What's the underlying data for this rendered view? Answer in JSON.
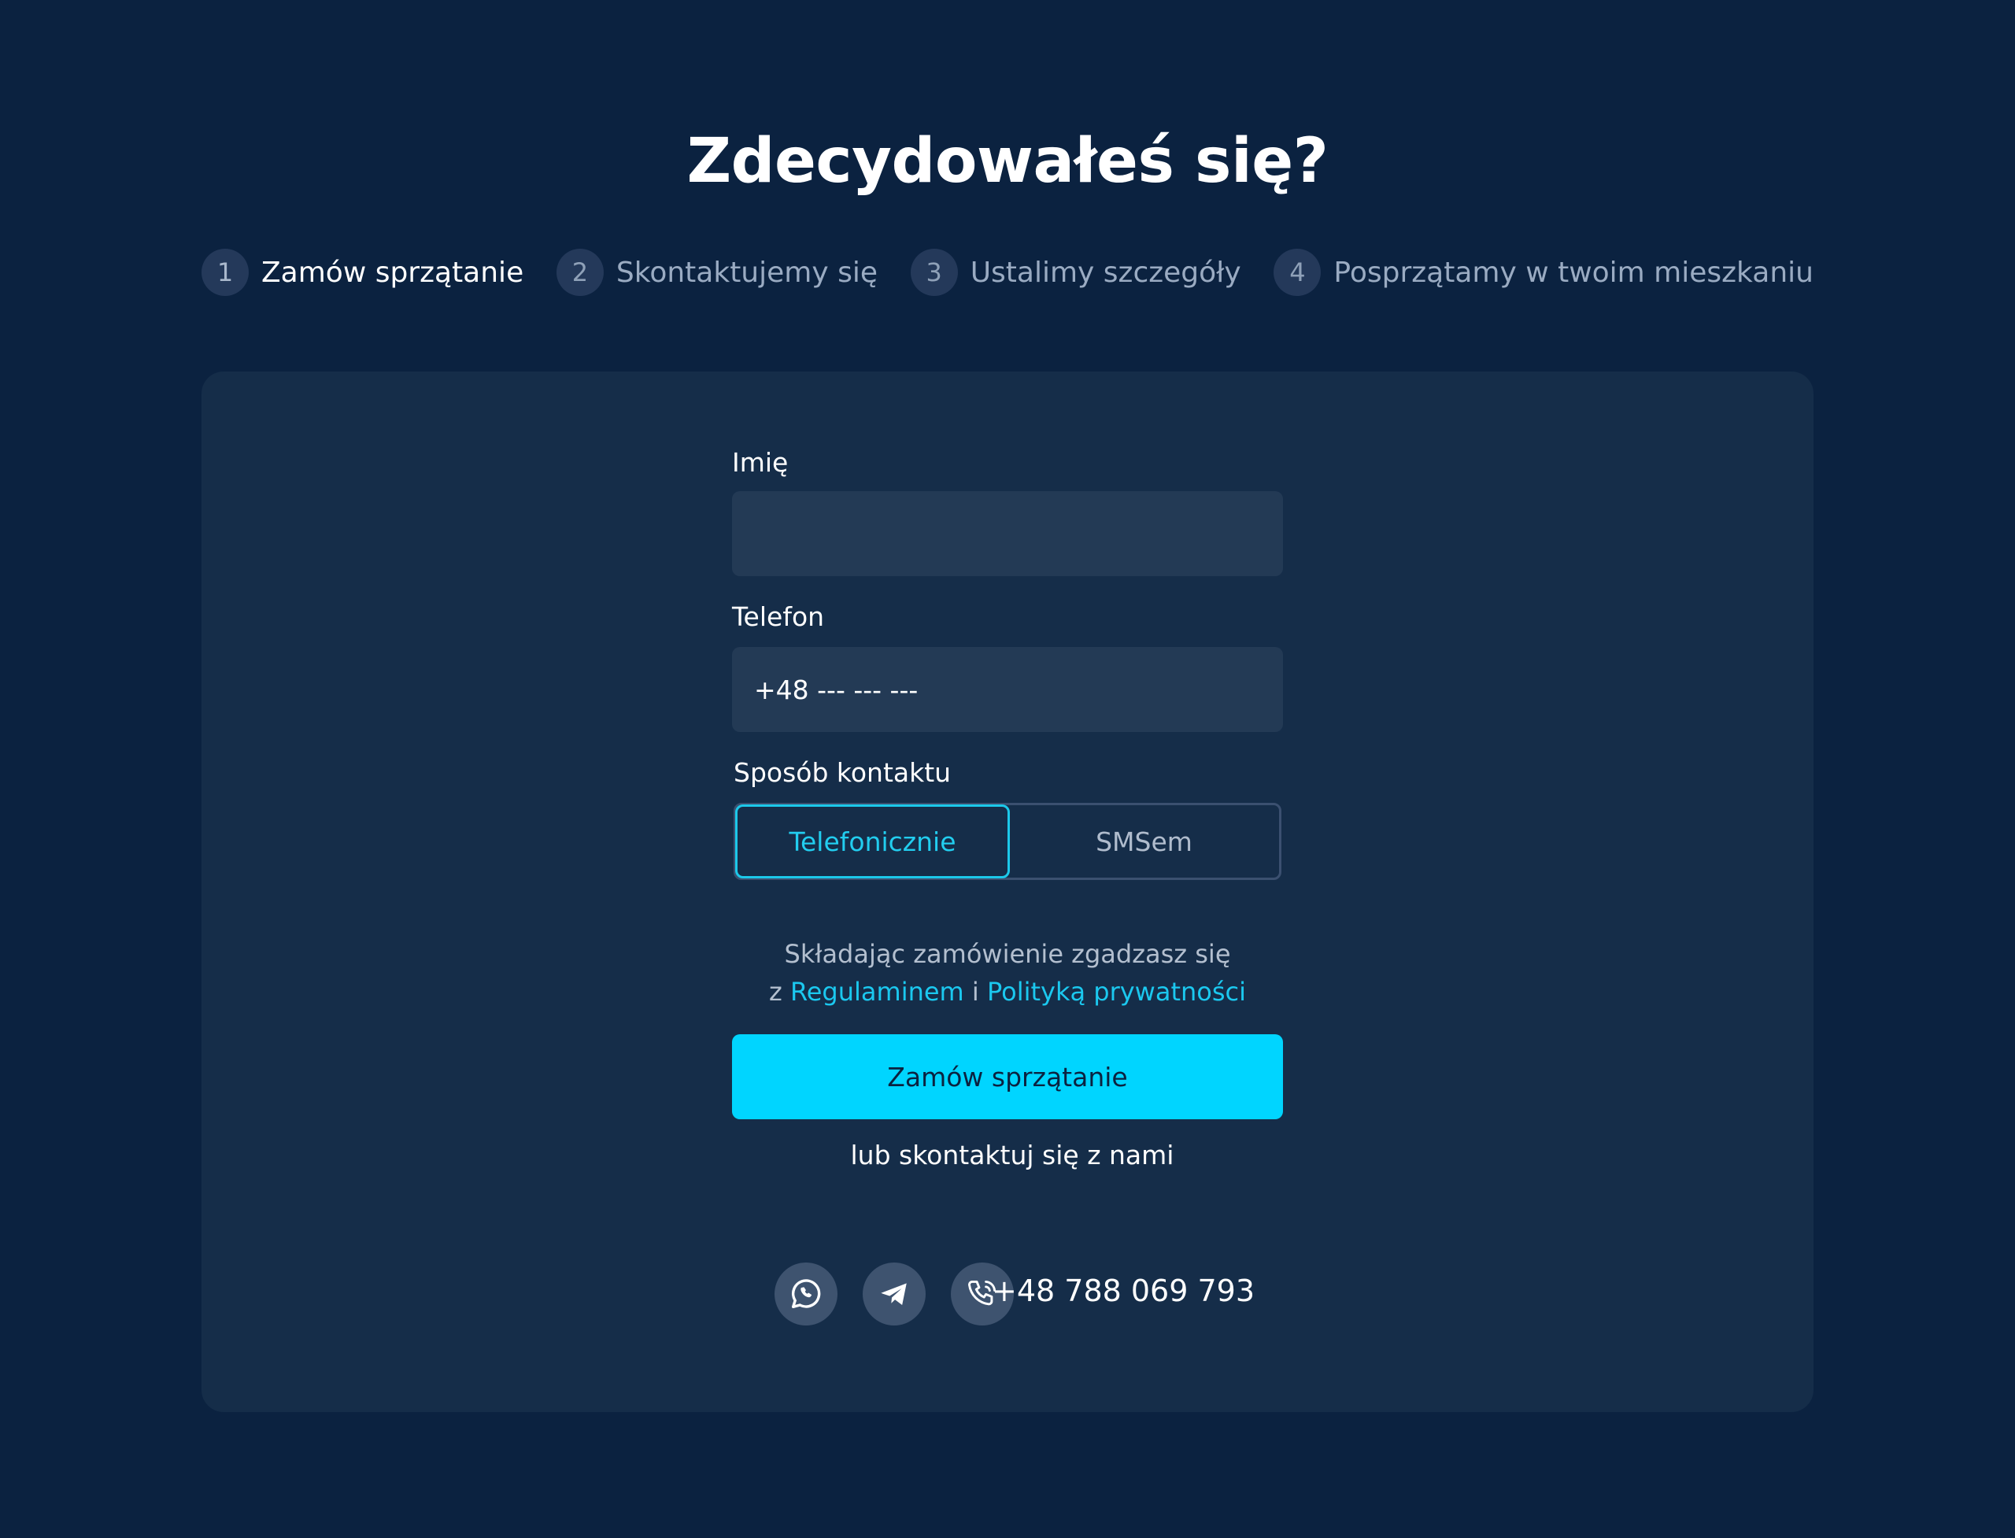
{
  "page": {
    "title": "Zdecydowałeś się?"
  },
  "steps": [
    {
      "num": "1",
      "label": "Zamów sprzątanie"
    },
    {
      "num": "2",
      "label": "Skontaktujemy się"
    },
    {
      "num": "3",
      "label": "Ustalimy szczegóły"
    },
    {
      "num": "4",
      "label": "Posprzątamy w twoim mieszkaniu"
    }
  ],
  "form": {
    "name_label": "Imię",
    "name_value": "",
    "phone_label": "Telefon",
    "phone_placeholder": "+48 --- --- ---",
    "contact_method_label": "Sposób kontaktu",
    "contact_options": [
      "Telefonicznie",
      "SMSem"
    ],
    "contact_selected": "Telefonicznie",
    "terms_line1": "Składając zamówienie zgadzasz się",
    "terms_prefix": "z",
    "terms_link": "Regulaminem",
    "terms_and": "i",
    "privacy_link": "Polityką prywatności",
    "submit_label": "Zamów sprzątanie"
  },
  "contact": {
    "heading": "lub skontaktuj się z nami",
    "icons": [
      "whatsapp-icon",
      "telegram-icon",
      "phone-call-icon"
    ],
    "phone": "+48 788 069 793"
  },
  "colors": {
    "background": "#0b2240",
    "card": "#152d49",
    "input": "#233a55",
    "accent": "#00d5ff"
  }
}
